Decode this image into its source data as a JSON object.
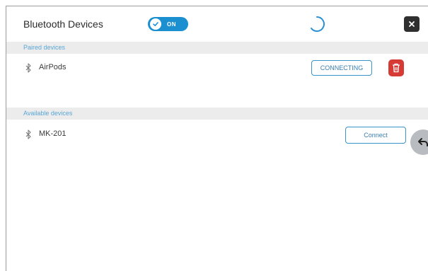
{
  "header": {
    "title": "Bluetooth Devices",
    "toggle_label": "ON",
    "toggle_state": "on"
  },
  "paired": {
    "section_label": "Paired devices",
    "devices": [
      {
        "name": "AirPods",
        "status_button": "CONNECTING"
      }
    ]
  },
  "available": {
    "section_label": "Available devices",
    "devices": [
      {
        "name": "MK-201",
        "action_button": "Connect"
      }
    ]
  },
  "colors": {
    "accent": "#1c8fd0",
    "delete": "#d63a35",
    "close": "#2f2f2f"
  },
  "icons": [
    "check-icon",
    "loading-spinner-icon",
    "close-icon",
    "bluetooth-icon",
    "trash-icon",
    "undo-icon"
  ]
}
